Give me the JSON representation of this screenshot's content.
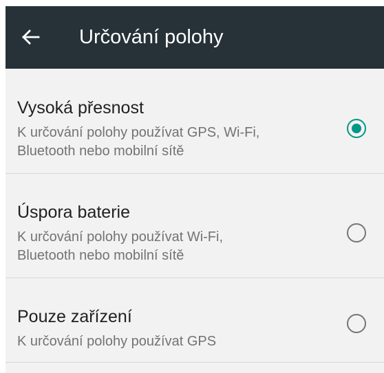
{
  "appbar": {
    "title": "Určování polohy",
    "back_icon": "arrow-back-icon",
    "background": "#263238"
  },
  "options": [
    {
      "title": "Vysoká přesnost",
      "subtitle_line1": "K určování polohy používat GPS, Wi-Fi,",
      "subtitle_line2": "Bluetooth nebo mobilní sítě",
      "selected": true
    },
    {
      "title": "Úspora baterie",
      "subtitle_line1": "K určování polohy používat Wi-Fi,",
      "subtitle_line2": "Bluetooth nebo mobilní sítě",
      "selected": false
    },
    {
      "title": "Pouze zařízení",
      "subtitle_line1": "K určování polohy používat GPS",
      "selected": false
    }
  ],
  "colors": {
    "accent": "#009688",
    "radio_unchecked": "#757575",
    "title_text": "#212121",
    "subtitle_text": "#737373"
  }
}
